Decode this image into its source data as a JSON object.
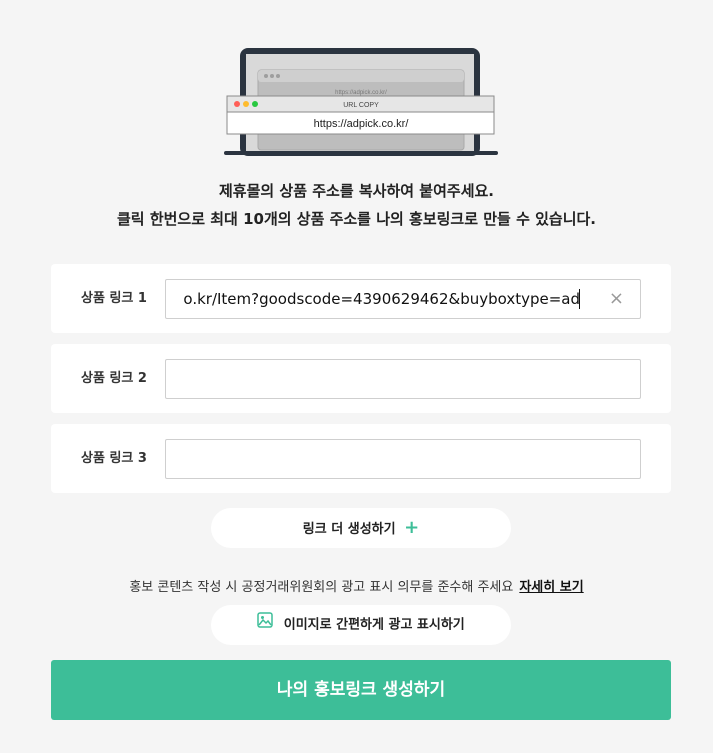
{
  "illustration": {
    "back_url": "https://adpick.co.kr/",
    "window_title": "URL COPY",
    "url": "https://adpick.co.kr/"
  },
  "intro": {
    "line1": "제휴몰의 상품 주소를 복사하여 붙여주세요.",
    "line2": "클릭 한번으로 최대 10개의 상품 주소를 나의 홍보링크로 만들 수 있습니다."
  },
  "links": [
    {
      "label": "상품 링크 1",
      "value": "o.kr/Item?goodscode=4390629462&buyboxtype=ad",
      "clear_icon": "×"
    },
    {
      "label": "상품 링크 2",
      "value": ""
    },
    {
      "label": "상품 링크 3",
      "value": ""
    }
  ],
  "more_button": {
    "label": "링크 더 생성하기",
    "icon": "+"
  },
  "notice": {
    "text": "홍보 콘텐츠 작성 시 공정거래위원회의 광고 표시 의무를 준수해 주세요",
    "link": "자세히 보기"
  },
  "image_ad_button": {
    "label": "이미지로 간편하게 광고 표시하기"
  },
  "submit_button": {
    "label": "나의 홍보링크 생성하기"
  },
  "colors": {
    "accent": "#3dbe98",
    "background": "#f5f5f5"
  }
}
